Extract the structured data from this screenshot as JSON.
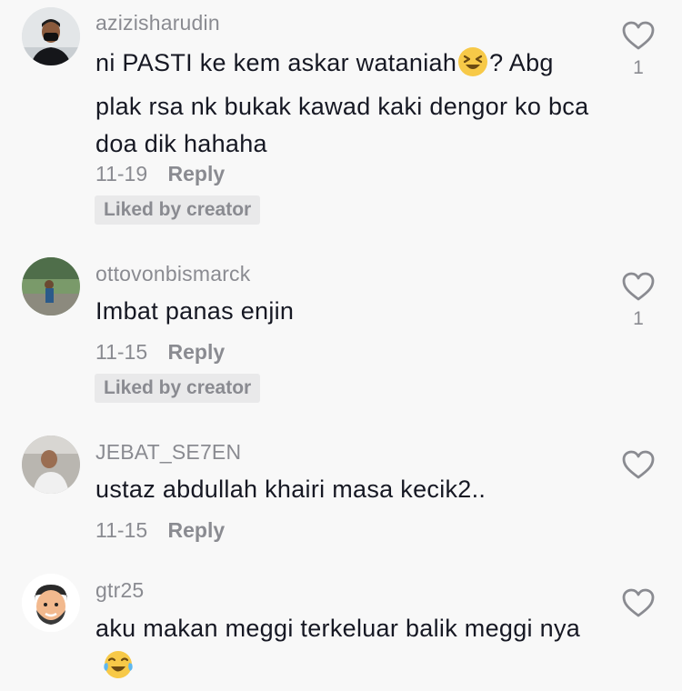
{
  "comments": [
    {
      "username": "azizisharudin",
      "text_before_emoji": "ni PASTI ke kem askar wataniah",
      "emoji": "laughing-squinting-face",
      "text_after_emoji": "? Abg plak rsa nk bukak kawad kaki dengor ko bca doa dik hahaha",
      "date": "11-19",
      "reply_label": "Reply",
      "badge": "Liked by creator",
      "like_count": "1"
    },
    {
      "username": "ottovonbismarck",
      "text": "Imbat panas enjin",
      "date": "11-15",
      "reply_label": "Reply",
      "badge": "Liked by creator",
      "like_count": "1"
    },
    {
      "username": "JEBAT_SE7EN",
      "text": "ustaz abdullah khairi masa kecik2..",
      "date": "11-15",
      "reply_label": "Reply"
    },
    {
      "username": "gtr25",
      "text": "aku makan meggi terkeluar balik meggi nya",
      "emoji": "face-with-tears-of-joy"
    }
  ],
  "colors": {
    "background": "#f8f8f8",
    "primary_text": "#161823",
    "secondary_text": "#8a8b91",
    "badge_background": "#e9e9ea",
    "emoji_yellow": "#f7c948"
  },
  "icons": {
    "like": "heart-outline-icon"
  }
}
